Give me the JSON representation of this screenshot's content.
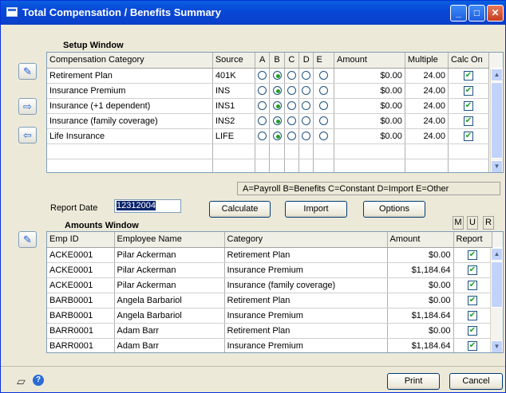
{
  "window": {
    "title": "Total Compensation / Benefits Summary"
  },
  "setup": {
    "label": "Setup Window",
    "headers": {
      "category": "Compensation Category",
      "source": "Source",
      "a": "A",
      "b": "B",
      "c": "C",
      "d": "D",
      "e": "E",
      "amount": "Amount",
      "multiple": "Multiple",
      "calc_on": "Calc On"
    },
    "rows": [
      {
        "category": "Retirement Plan",
        "source": "401K",
        "selected": "B",
        "amount": "$0.00",
        "multiple": "24.00",
        "calc_on": true
      },
      {
        "category": "Insurance Premium",
        "source": "INS",
        "selected": "B",
        "amount": "$0.00",
        "multiple": "24.00",
        "calc_on": true
      },
      {
        "category": "Insurance (+1 dependent)",
        "source": "INS1",
        "selected": "B",
        "amount": "$0.00",
        "multiple": "24.00",
        "calc_on": true
      },
      {
        "category": "Insurance (family coverage)",
        "source": "INS2",
        "selected": "B",
        "amount": "$0.00",
        "multiple": "24.00",
        "calc_on": true
      },
      {
        "category": "Life Insurance",
        "source": "LIFE",
        "selected": "B",
        "amount": "$0.00",
        "multiple": "24.00",
        "calc_on": true
      }
    ],
    "legend": "A=Payroll B=Benefits C=Constant D=Import E=Other"
  },
  "report_date": {
    "label": "Report Date",
    "value": "12312004"
  },
  "buttons": {
    "calculate": "Calculate",
    "import": "Import",
    "options": "Options",
    "print": "Print",
    "cancel": "Cancel"
  },
  "amounts": {
    "label": "Amounts Window",
    "mur": {
      "m": "M",
      "u": "U",
      "r": "R"
    },
    "headers": {
      "emp_id": "Emp ID",
      "name": "Employee Name",
      "category": "Category",
      "amount": "Amount",
      "report": "Report"
    },
    "rows": [
      {
        "emp_id": "ACKE0001",
        "name": "Pilar Ackerman",
        "category": "Retirement Plan",
        "amount": "$0.00",
        "report": true
      },
      {
        "emp_id": "ACKE0001",
        "name": "Pilar Ackerman",
        "category": "Insurance Premium",
        "amount": "$1,184.64",
        "report": true
      },
      {
        "emp_id": "ACKE0001",
        "name": "Pilar Ackerman",
        "category": "Insurance (family coverage)",
        "amount": "$0.00",
        "report": true
      },
      {
        "emp_id": "BARB0001",
        "name": "Angela Barbariol",
        "category": "Retirement Plan",
        "amount": "$0.00",
        "report": true
      },
      {
        "emp_id": "BARB0001",
        "name": "Angela Barbariol",
        "category": "Insurance Premium",
        "amount": "$1,184.64",
        "report": true
      },
      {
        "emp_id": "BARR0001",
        "name": "Adam Barr",
        "category": "Retirement Plan",
        "amount": "$0.00",
        "report": true
      },
      {
        "emp_id": "BARR0001",
        "name": "Adam Barr",
        "category": "Insurance Premium",
        "amount": "$1,184.64",
        "report": true
      }
    ]
  },
  "icons": {
    "title": "window-icon",
    "edit": "eraser-icon",
    "insert": "arrow-right-icon",
    "remove": "arrow-left-icon",
    "note": "note-icon",
    "help": "help-icon"
  }
}
